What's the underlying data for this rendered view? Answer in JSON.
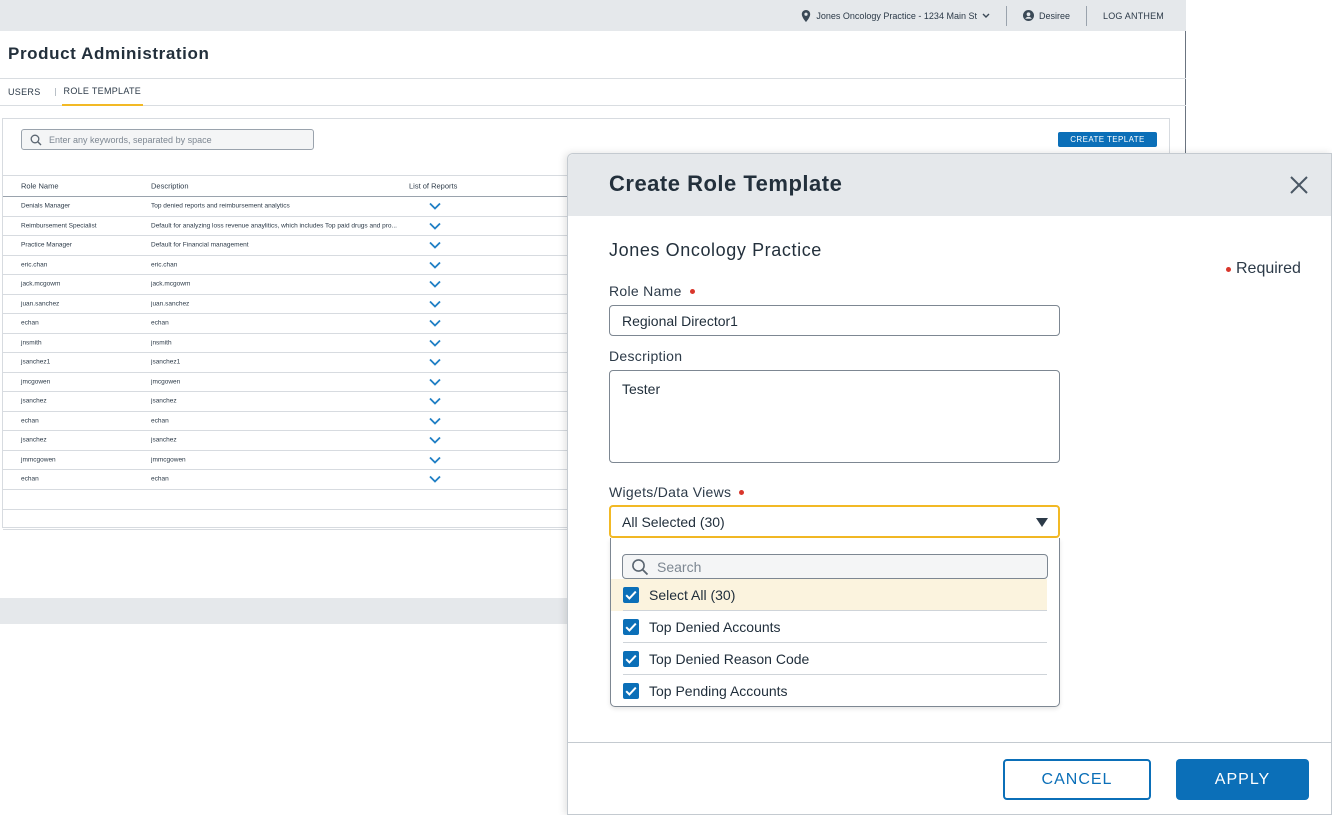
{
  "topbar": {
    "location": "Jones Oncology Practice - 1234 Main St",
    "user": "Desiree",
    "logout": "LOG ANTHEM"
  },
  "page": {
    "title": "Product Administration"
  },
  "tabs": [
    {
      "label": "USERS"
    },
    {
      "label": "ROLE TEMPLATE",
      "active": true
    }
  ],
  "search": {
    "placeholder": "Enter any keywords, separated by space"
  },
  "create_button": "CREATE TEPLATE",
  "table": {
    "headers": [
      "Role Name",
      "Description",
      "List of Reports"
    ],
    "rows": [
      {
        "name": "Denials Manager",
        "description": "Top denied reports and reimbursement analytics"
      },
      {
        "name": "Reimbursement Specialist",
        "description": "Default for analyzing loss revenue anaylitics, which includes Top paid drugs and pro..."
      },
      {
        "name": "Practice Manager",
        "description": "Default for Financial management"
      },
      {
        "name": "eric.chan",
        "description": "eric.chan"
      },
      {
        "name": "jack.mcgowm",
        "description": "jack.mcgowm"
      },
      {
        "name": "juan.sanchez",
        "description": "juan.sanchez"
      },
      {
        "name": "echan",
        "description": "echan"
      },
      {
        "name": "jnsmith",
        "description": "jnsmith"
      },
      {
        "name": "jsanchez1",
        "description": "jsanchez1"
      },
      {
        "name": "jmcgowen",
        "description": "jmcgowen"
      },
      {
        "name": "jsanchez",
        "description": "jsanchez"
      },
      {
        "name": "echan",
        "description": "echan"
      },
      {
        "name": "jsanchez",
        "description": "jsanchez"
      },
      {
        "name": "jmmcgowen",
        "description": "jmmcgowen"
      },
      {
        "name": "echan",
        "description": "echan"
      }
    ]
  },
  "modal": {
    "title": "Create Role Template",
    "practice": "Jones Oncology Practice",
    "required_label": "Required",
    "role_name_label": "Role Name",
    "role_name_value": "Regional Director1",
    "description_label": "Description",
    "description_value": "Tester",
    "widgets_label": "Wigets/Data Views",
    "widgets_value": "All Selected (30)",
    "dropdown_search_placeholder": "Search",
    "options": [
      {
        "label": "Select All (30)",
        "checked": true
      },
      {
        "label": "Top Denied Accounts",
        "checked": true
      },
      {
        "label": "Top Denied Reason Code",
        "checked": true
      },
      {
        "label": "Top Pending Accounts",
        "checked": true
      }
    ],
    "cancel_label": "CANCEL",
    "apply_label": "APPLY"
  },
  "colors": {
    "primary": "#0b6fb8",
    "accent": "#f2b925",
    "required_dot": "#d9362b"
  }
}
